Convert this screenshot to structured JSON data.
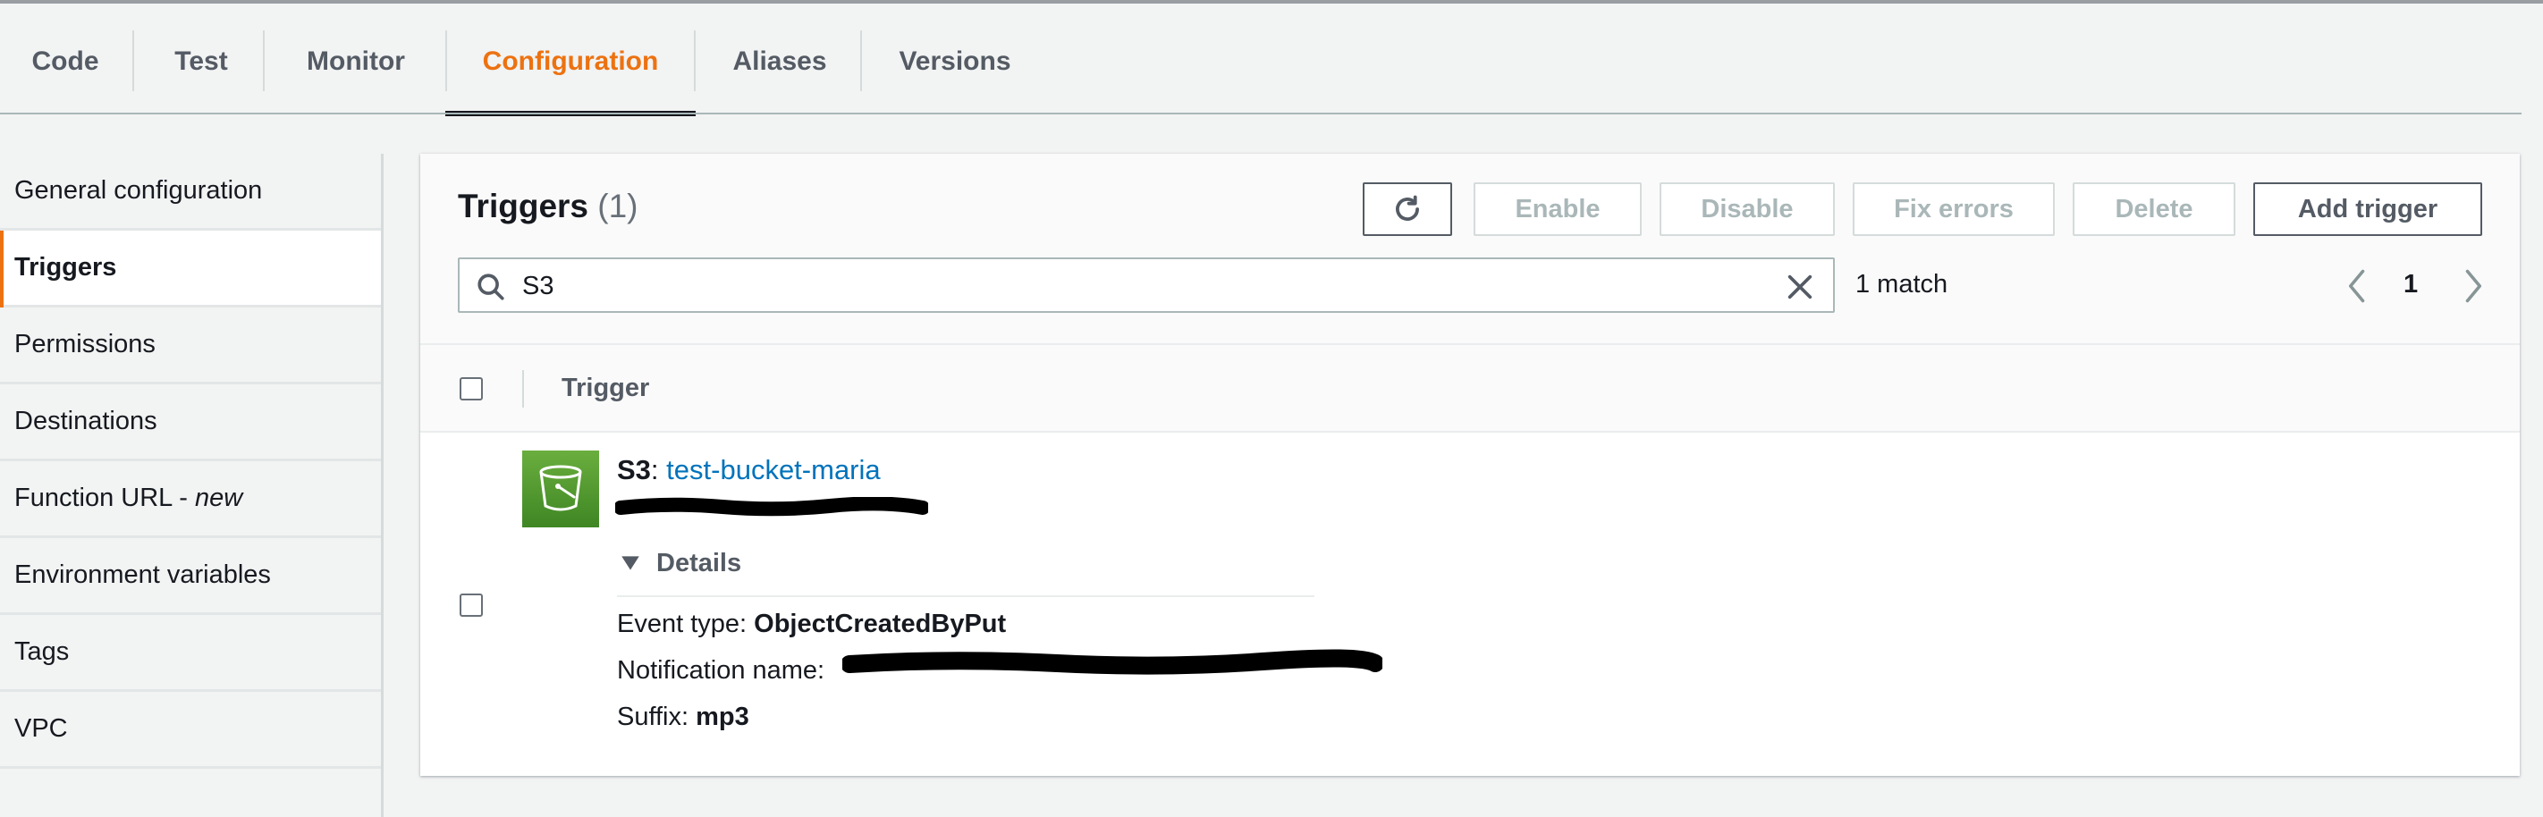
{
  "tabs": [
    {
      "label": "Code"
    },
    {
      "label": "Test"
    },
    {
      "label": "Monitor"
    },
    {
      "label": "Configuration",
      "active": true
    },
    {
      "label": "Aliases"
    },
    {
      "label": "Versions"
    }
  ],
  "sidebar": {
    "items": [
      {
        "label": "General configuration"
      },
      {
        "label": "Triggers",
        "active": true
      },
      {
        "label": "Permissions"
      },
      {
        "label": "Destinations"
      },
      {
        "label": "Function URL - ",
        "badge": "new"
      },
      {
        "label": "Environment variables"
      },
      {
        "label": "Tags"
      },
      {
        "label": "VPC"
      }
    ]
  },
  "triggers_panel": {
    "title": "Triggers",
    "count": "(1)",
    "buttons": {
      "refresh_icon": "refresh-icon",
      "enable": "Enable",
      "disable": "Disable",
      "fix_errors": "Fix errors",
      "delete": "Delete",
      "add_trigger": "Add trigger"
    },
    "search": {
      "value": "S3",
      "icon": "search-icon"
    },
    "match_count": "1 match",
    "pagination": {
      "current_page": "1"
    },
    "table": {
      "column": "Trigger",
      "rows": [
        {
          "service": "S3",
          "separator": ":",
          "resource": "test-bucket-maria",
          "details_label": "Details",
          "event_type_label": "Event type: ",
          "event_type_value": "ObjectCreatedByPut",
          "notification_name_label": "Notification name:",
          "suffix_label": "Suffix: ",
          "suffix_value": "mp3"
        }
      ]
    }
  },
  "colors": {
    "accent": "#ec7211",
    "link": "#0073bb",
    "s3_green": "#3f8624",
    "disabled_text": "#aab7b8"
  }
}
